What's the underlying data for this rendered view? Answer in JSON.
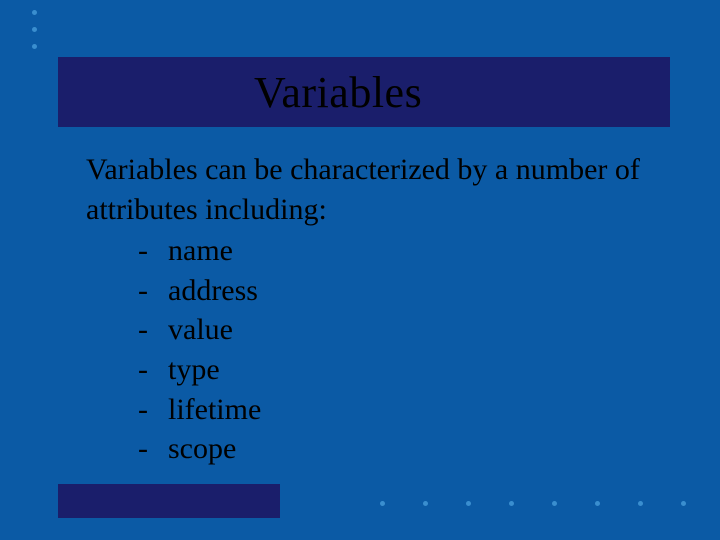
{
  "title": "Variables",
  "intro": "Variables can be characterized by a number of attributes including:",
  "items": [
    "name",
    "address",
    "value",
    "type",
    "lifetime",
    "scope"
  ]
}
